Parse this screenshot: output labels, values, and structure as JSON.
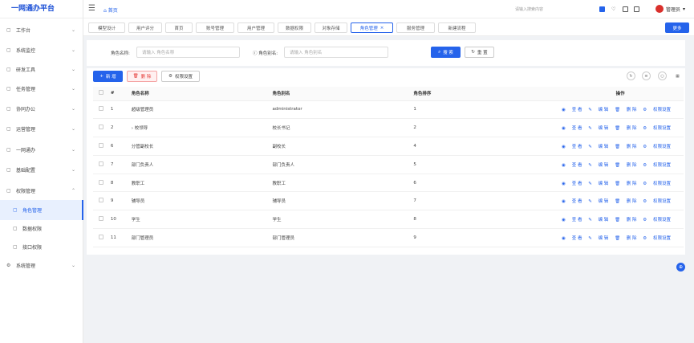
{
  "app": {
    "title": "一网通办平台"
  },
  "header": {
    "home_label": "首页",
    "search_placeholder": "请输入搜索内容",
    "user_name": "管理员"
  },
  "sidebar": {
    "items": [
      {
        "label": "工作台",
        "icon": "monitor-icon"
      },
      {
        "label": "系统监控",
        "icon": "dashboard-icon"
      },
      {
        "label": "研发工具",
        "icon": "tools-icon"
      },
      {
        "label": "任务管理",
        "icon": "task-icon"
      },
      {
        "label": "协同办公",
        "icon": "collab-icon"
      },
      {
        "label": "运营管理",
        "icon": "ops-icon"
      },
      {
        "label": "一网通办",
        "icon": "user-icon"
      },
      {
        "label": "基础配置",
        "icon": "config-icon"
      },
      {
        "label": "权限管理",
        "icon": "lock-icon"
      }
    ],
    "sub_items": [
      {
        "label": "角色管理",
        "icon": "role-icon"
      },
      {
        "label": "数据权限",
        "icon": "data-icon"
      },
      {
        "label": "接口权限",
        "icon": "api-icon"
      }
    ],
    "last_item": {
      "label": "系统管理",
      "icon": "settings-icon"
    }
  },
  "tabs": [
    "模型设计",
    "用户评分",
    "首页",
    "账号管理",
    "用户管理",
    "数据权限",
    "对象存储",
    "角色管理",
    "服务管理",
    "新建流程"
  ],
  "more_label": "更多",
  "search_form": {
    "role_name_label": "角色名称:",
    "role_name_placeholder": "请输入 角色名称",
    "role_alias_label": "角色别名:",
    "role_alias_placeholder": "请输入 角色别名",
    "search_btn": "搜 索",
    "reset_btn": "重 置"
  },
  "toolbar": {
    "add": "新 增",
    "delete": "删 除",
    "perm": "权限设置"
  },
  "table": {
    "headers": [
      "#",
      "角色名称",
      "角色别名",
      "角色排序",
      "操作"
    ],
    "rows": [
      {
        "idx": "1",
        "name": "超级管理员",
        "alias": "administrator",
        "order": "1"
      },
      {
        "idx": "2",
        "name": "› 校领导",
        "alias": "校长书记",
        "order": "2"
      },
      {
        "idx": "6",
        "name": "分管副校长",
        "alias": "副校长",
        "order": "4"
      },
      {
        "idx": "7",
        "name": "部门负责人",
        "alias": "部门负责人",
        "order": "5"
      },
      {
        "idx": "8",
        "name": "教职工",
        "alias": "教职工",
        "order": "6"
      },
      {
        "idx": "9",
        "name": "辅导员",
        "alias": "辅导员",
        "order": "7"
      },
      {
        "idx": "10",
        "name": "学生",
        "alias": "学生",
        "order": "8"
      },
      {
        "idx": "11",
        "name": "部门管理员",
        "alias": "部门管理员",
        "order": "9"
      }
    ],
    "ops": [
      "查 看",
      "编 辑",
      "删 除",
      "权限设置"
    ]
  }
}
